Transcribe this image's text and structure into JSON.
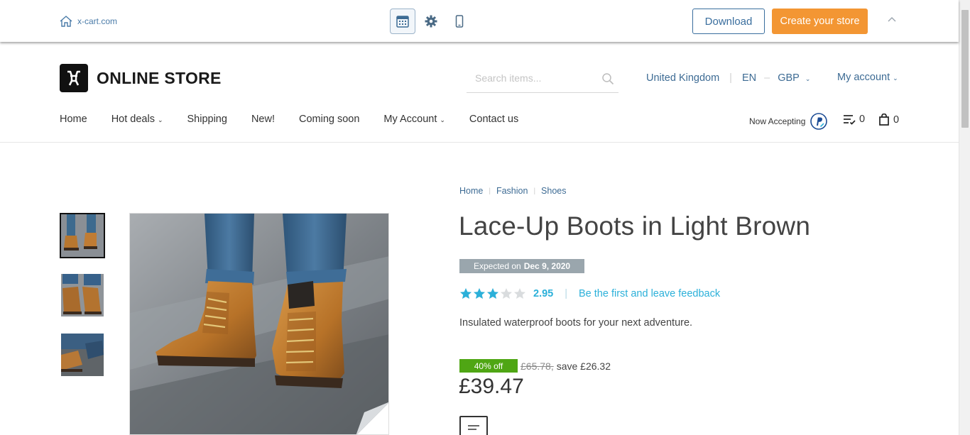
{
  "demo_bar": {
    "site_link": "x-cart.com",
    "download_label": "Download",
    "create_label": "Create your store"
  },
  "header": {
    "logo_text": "ONLINE STORE",
    "search_placeholder": "Search items...",
    "country": "United Kingdom",
    "language": "EN",
    "currency": "GBP",
    "account": "My account"
  },
  "nav": {
    "items": [
      "Home",
      "Hot deals",
      "Shipping",
      "New!",
      "Coming soon",
      "My Account",
      "Contact us"
    ],
    "now_accepting": "Now Accepting",
    "compare_count": "0",
    "cart_count": "0"
  },
  "breadcrumb": [
    "Home",
    "Fashion",
    "Shoes"
  ],
  "product": {
    "title": "Lace-Up Boots in Light Brown",
    "expected_label": "Expected on",
    "expected_date": "Dec 9, 2020",
    "rating": "2.95",
    "rating_fraction": 0.59,
    "feedback_link": "Be the first and leave feedback",
    "description": "Insulated waterproof boots for your next adventure.",
    "discount_badge": "40% off",
    "old_price": "£65.78,",
    "save_text": "save £26.32",
    "price": "£39.47"
  },
  "colors": {
    "accent_orange": "#f39633",
    "link_blue": "#3d6b94",
    "rating_blue": "#2bb0d9",
    "discount_green": "#4fa614",
    "badge_gray": "#9aa6ad"
  }
}
